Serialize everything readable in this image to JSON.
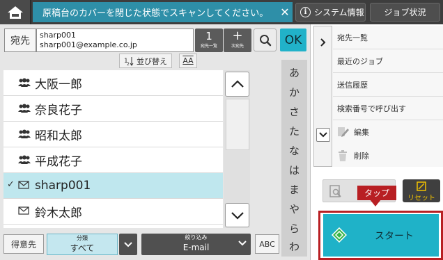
{
  "topbar": {
    "message": "原稿台のカバーを閉じた状態でスキャンしてください。",
    "close_glyph": "✕",
    "system_info": "システム情報",
    "job_status": "ジョブ状況"
  },
  "address": {
    "label": "宛先",
    "name": "sharp001",
    "email": "sharp001@example.co.jp",
    "count": "1",
    "count_caption": "宛先一覧",
    "add_caption": "次宛先",
    "ok": "OK"
  },
  "sort": {
    "label": "並び替え",
    "aa": "AA"
  },
  "list": {
    "items": [
      {
        "name": "大阪一郎",
        "type": "group"
      },
      {
        "name": "奈良花子",
        "type": "group"
      },
      {
        "name": "昭和太郎",
        "type": "group"
      },
      {
        "name": "平成花子",
        "type": "group"
      },
      {
        "name": "sharp001",
        "type": "email",
        "selected": true
      },
      {
        "name": "鈴木太郎",
        "type": "email"
      }
    ]
  },
  "kana": [
    "あ",
    "か",
    "さ",
    "た",
    "な",
    "は",
    "ま",
    "や",
    "ら",
    "わ"
  ],
  "bottom": {
    "tokui": "得意先",
    "category_caption": "分類",
    "category_value": "すべて",
    "filter_caption": "絞り込み",
    "filter_value": "E-mail",
    "abc": "ABC"
  },
  "side": {
    "items": [
      "宛先一覧",
      "最近のジョブ",
      "送信履歴",
      "検索番号で呼び出す",
      "編集",
      "削除"
    ]
  },
  "actions": {
    "reset": "リセット",
    "tap": "タップ",
    "start": "スタート"
  },
  "colors": {
    "accent": "#1fb2c8",
    "highlight": "#b81f23",
    "selected_row": "#bfe7ee",
    "info_bar": "#2e8fa8"
  }
}
